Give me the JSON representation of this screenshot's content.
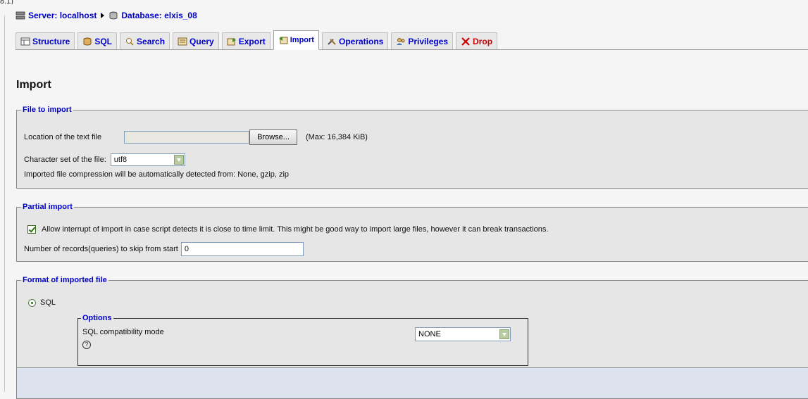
{
  "header_fragment": "8.1)",
  "breadcrumb": {
    "server": "Server: localhost",
    "database": "Database: elxis_08"
  },
  "tabs": [
    {
      "label": "Structure",
      "icon": "structure-icon"
    },
    {
      "label": "SQL",
      "icon": "sql-icon"
    },
    {
      "label": "Search",
      "icon": "search-icon"
    },
    {
      "label": "Query",
      "icon": "query-icon"
    },
    {
      "label": "Export",
      "icon": "export-icon"
    },
    {
      "label": "Import",
      "icon": "import-icon",
      "active": true
    },
    {
      "label": "Operations",
      "icon": "operations-icon"
    },
    {
      "label": "Privileges",
      "icon": "privileges-icon"
    },
    {
      "label": "Drop",
      "icon": "drop-icon"
    }
  ],
  "page": {
    "title": "Import"
  },
  "file_to_import": {
    "legend": "File to import",
    "location_label": "Location of the text file",
    "browse_label": "Browse...",
    "max_size": "(Max: 16,384 KiB)",
    "charset_label": "Character set of the file:",
    "charset_value": "utf8",
    "compression_note": "Imported file compression will be automatically detected from: None, gzip, zip"
  },
  "partial_import": {
    "legend": "Partial import",
    "interrupt_label": "Allow interrupt of import in case script detects it is close to time limit. This might be good way to import large files, however it can break transactions.",
    "interrupt_checked": true,
    "skip_label": "Number of records(queries) to skip from start",
    "skip_value": "0"
  },
  "format": {
    "legend": "Format of imported file",
    "sql_label": "SQL",
    "options_legend": "Options",
    "compat_label": "SQL compatibility mode",
    "compat_value": "NONE",
    "help_icon": "help-icon"
  },
  "colors": {
    "link": "#0000cc",
    "drop": "#cc0000",
    "panel": "#e6e6e6"
  }
}
